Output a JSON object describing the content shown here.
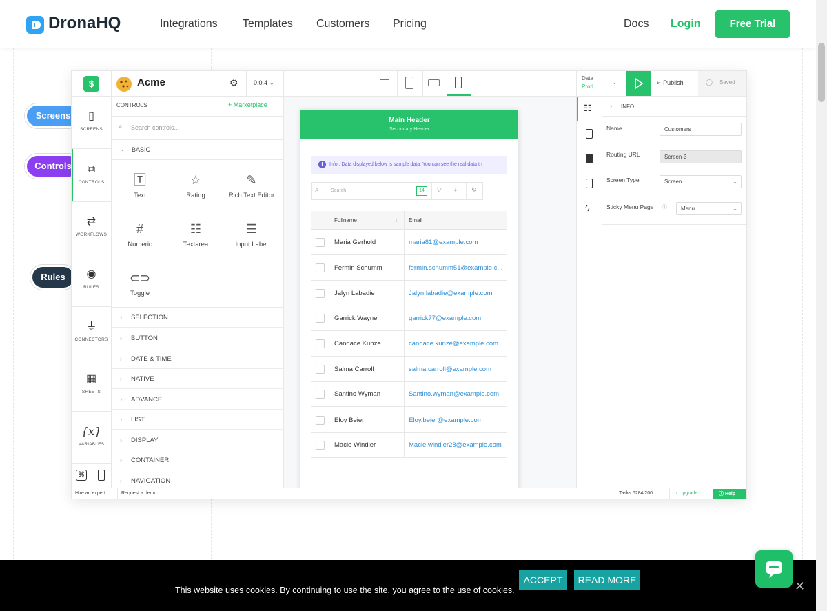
{
  "nav": {
    "brand": "DronaHQ",
    "links": [
      "Integrations",
      "Templates",
      "Customers",
      "Pricing"
    ],
    "docs": "Docs",
    "login": "Login",
    "free_trial": "Free Trial"
  },
  "pills": {
    "screens": "Screens",
    "controls": "Controls",
    "rules": "Rules"
  },
  "app": {
    "name": "Acme",
    "version": "0.0.4",
    "rail": [
      "SCREENS",
      "CONTROLS",
      "WORKFLOWS",
      "RULES",
      "CONNECTORS",
      "SHEETS",
      "VARIABLES"
    ],
    "controls_title": "CONTROLS",
    "marketplace": "+ Marketplace",
    "search_placeholder": "Search controls...",
    "basic": "BASIC",
    "basic_controls": [
      "Text",
      "Rating",
      "Rich Text Editor",
      "Numeric",
      "Textarea",
      "Input Label",
      "Toggle"
    ],
    "categories": [
      "SELECTION",
      "BUTTON",
      "DATE & TIME",
      "NATIVE",
      "ADVANCE",
      "LIST",
      "DISPLAY",
      "CONTAINER",
      "NAVIGATION"
    ],
    "env_label": "Data",
    "env_value": "Prod",
    "publish": "Publish",
    "saved": "Saved",
    "footer": {
      "hire": "Hire an expert",
      "demo": "Request a demo",
      "tasks": "Tasks 6284/200",
      "upgrade": "Upgrade",
      "help": "Help"
    }
  },
  "phone": {
    "header": "Main Header",
    "subheader": "Secondary Header",
    "info": "Info : Data displayed below is sample data. You can see the real data th",
    "search_placeholder": "Search",
    "count": "14",
    "col_name": "Fullname",
    "col_email": "Email",
    "rows": [
      {
        "name": "Maria Gerhold",
        "email": "maria81@example.com"
      },
      {
        "name": "Fermin Schumm",
        "email": "fermin.schumm51@example.c..."
      },
      {
        "name": "Jalyn Labadie",
        "email": "Jalyn.labadie@example.com"
      },
      {
        "name": "Garrick Wayne",
        "email": "garrick77@example.com"
      },
      {
        "name": "Candace Kunze",
        "email": "candace.kunze@example.com"
      },
      {
        "name": "Salma Carroll",
        "email": "salma.carroll@example.com"
      },
      {
        "name": "Santino Wyman",
        "email": "Santino.wyman@example.com"
      },
      {
        "name": "Eloy Beier",
        "email": "Eloy.beier@example.com"
      },
      {
        "name": "Macie Windler",
        "email": "Macie.windler28@example.com"
      }
    ]
  },
  "props": {
    "section": "INFO",
    "name_label": "Name",
    "name_value": "Customers",
    "url_label": "Routing URL",
    "url_value": "Screen-3",
    "type_label": "Screen Type",
    "type_value": "Screen",
    "sticky_label": "Sticky Menu Page",
    "sticky_value": "Menu"
  },
  "cookie": {
    "text": "This website uses cookies. By continuing to use the site, you agree to the use of cookies.",
    "accept": "ACCEPT",
    "read_more": "READ MORE"
  },
  "colors": {
    "brand_green": "#27c26b",
    "screens_pill": "#4a9ff5",
    "controls_pill": "#8b3ff0",
    "rules_pill": "#24384a",
    "cookie_btn": "#19a2a2"
  }
}
